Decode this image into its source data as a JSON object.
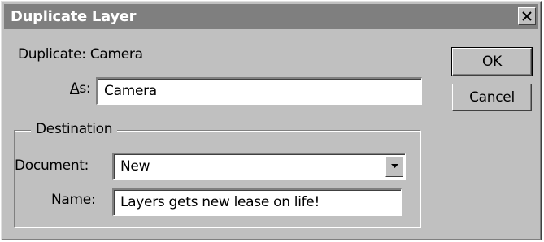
{
  "window": {
    "title": "Duplicate Layer"
  },
  "duplicate": {
    "prefix": "Duplicate: ",
    "layer_name": "Camera"
  },
  "as_field": {
    "label_accel": "A",
    "label_rest": "s:",
    "value": "Camera"
  },
  "buttons": {
    "ok_label": "OK",
    "cancel_label": "Cancel"
  },
  "destination": {
    "legend": "Destination",
    "document": {
      "label_accel": "D",
      "label_rest": "ocument:",
      "selected": "New"
    },
    "name": {
      "label_accel": "N",
      "label_rest": "ame:",
      "value": "Layers gets new lease on life!"
    }
  },
  "icons": {
    "close": "close-icon",
    "dropdown": "chevron-down-icon"
  },
  "colors": {
    "titlebar": "#7f7f7f",
    "face": "#c0c0c0",
    "field": "#ffffff"
  }
}
